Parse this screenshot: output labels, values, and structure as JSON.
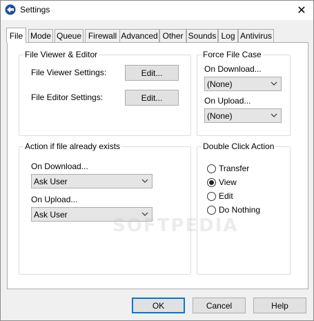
{
  "window": {
    "title": "Settings",
    "close_glyph": "✕"
  },
  "tabs": [
    {
      "label": "File",
      "active": true
    },
    {
      "label": "Mode"
    },
    {
      "label": "Queue"
    },
    {
      "label": "Firewall"
    },
    {
      "label": "Advanced"
    },
    {
      "label": "Other"
    },
    {
      "label": "Sounds"
    },
    {
      "label": "Log"
    },
    {
      "label": "Antivirus"
    }
  ],
  "file_viewer": {
    "title": "File Viewer & Editor",
    "viewer_label": "File Viewer Settings:",
    "viewer_button": "Edit...",
    "editor_label": "File Editor Settings:",
    "editor_button": "Edit..."
  },
  "force_case": {
    "title": "Force File Case",
    "download_label": "On Download...",
    "download_value": "(None)",
    "upload_label": "On Upload...",
    "upload_value": "(None)"
  },
  "exists_action": {
    "title": "Action if file already exists",
    "download_label": "On Download...",
    "download_value": "Ask User",
    "upload_label": "On Upload...",
    "upload_value": "Ask User"
  },
  "double_click": {
    "title": "Double Click Action",
    "options": [
      {
        "label": "Transfer",
        "checked": false
      },
      {
        "label": "View",
        "checked": true
      },
      {
        "label": "Edit",
        "checked": false
      },
      {
        "label": "Do Nothing",
        "checked": false
      }
    ]
  },
  "watermark": "SOFTPEDIA",
  "footer": {
    "ok": "OK",
    "cancel": "Cancel",
    "help": "Help"
  }
}
